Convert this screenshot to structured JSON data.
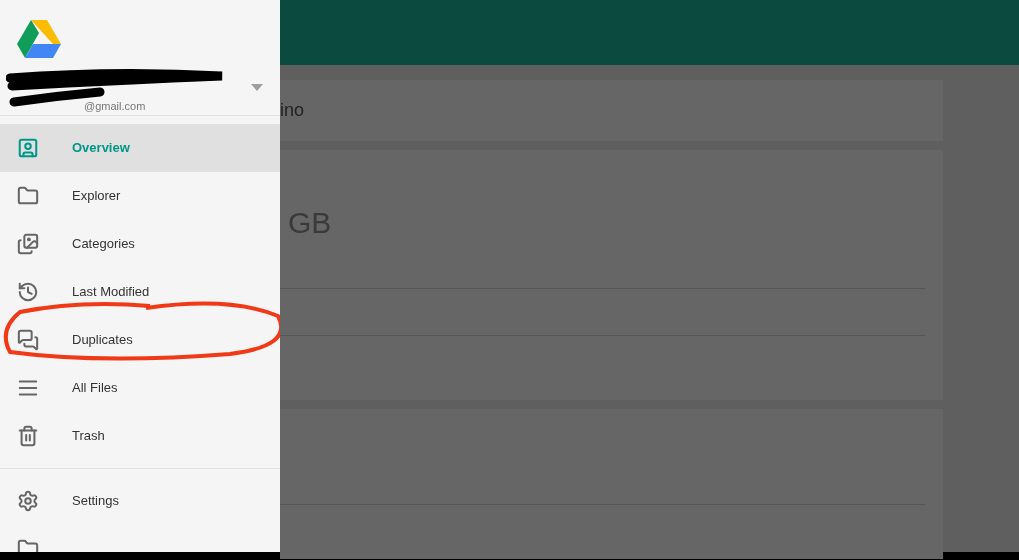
{
  "drawer": {
    "account": {
      "email": "@gmail.com"
    },
    "items": [
      {
        "label": "Overview",
        "selected": true
      },
      {
        "label": "Explorer",
        "selected": false
      },
      {
        "label": "Categories",
        "selected": false
      },
      {
        "label": "Last Modified",
        "selected": false
      },
      {
        "label": "Duplicates",
        "selected": false
      },
      {
        "label": "All Files",
        "selected": false
      },
      {
        "label": "Trash",
        "selected": false
      }
    ],
    "footer_items": [
      {
        "label": "Settings"
      }
    ]
  },
  "main": {
    "account_card": {
      "text": "ino"
    },
    "storage_card": {
      "size": "GB"
    }
  }
}
